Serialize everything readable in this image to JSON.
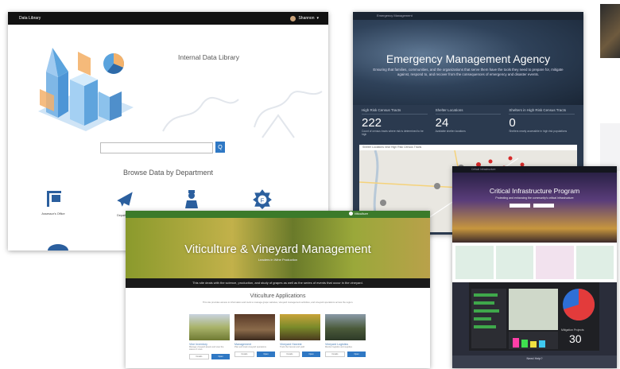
{
  "data_library": {
    "bar_title": "Data Library",
    "user": "Shannon",
    "title": "Internal Data Library",
    "search_button": "Q",
    "browse_heading": "Browse Data by Department",
    "departments": [
      {
        "icon": "sign-icon",
        "label": "Assessor's Office"
      },
      {
        "icon": "airplane-icon",
        "label": "Department"
      }
    ],
    "colors": {
      "accent": "#2f78c4",
      "bar": "#111111"
    }
  },
  "emergency": {
    "topbar": "Emergency Management",
    "title": "Emergency Management Agency",
    "tagline": "Ensuring that families, communities, and the organizations that serve them have the tools they need to prepare for, mitigate against, respond to, and recover from the consequences of emergency and disaster events.",
    "stats": [
      {
        "label": "High Risk Census Tracts",
        "value": "222",
        "desc": "Count of census tracts where risk is determined to be high"
      },
      {
        "label": "Shelter Locations",
        "value": "24",
        "desc": "Available shelter locations"
      },
      {
        "label": "Shelters in High Risk Census Tracts",
        "value": "0",
        "desc": "Shelters nearly accessible in high risk populations"
      }
    ],
    "map_title": "Shelter Locations near High Risk Census Tracts"
  },
  "critical": {
    "topbar": "Critical Infrastructure",
    "title": "Critical Infrastructure Program",
    "subtitle": "Protecting and enhancing the community's critical infrastructure",
    "dashboard_value": "30",
    "dashboard_label": "Mitigation Projects",
    "footer_title": "Need Help?"
  },
  "viticulture": {
    "brand": "Viticulture",
    "title": "Viticulture & Vineyard Management",
    "subtitle": "Leaders in Wine Production",
    "banner": "This site deals with the science, production, and study of grapes as well as the series of events that occur in the vineyard.",
    "apps_title": "Viticulture Applications",
    "apps_desc": "This site provides access to information and tools to manage grape varieties, vineyard management activities, and vineyard operations across the region.",
    "apps": [
      {
        "name": "Vine Inventory",
        "desc": "Manage vineyard assets and view the status of vines",
        "secondary": "Details",
        "primary": "Open"
      },
      {
        "name": "Management",
        "desc": "Plan and track vineyard operations",
        "secondary": "Details",
        "primary": "Open"
      },
      {
        "name": "Vineyard Harvest",
        "desc": "Track the harvest and yield",
        "secondary": "Details",
        "primary": "Open"
      },
      {
        "name": "Vineyard Logistics",
        "desc": "Monitor logistics and supplies",
        "secondary": "Details",
        "primary": "Open"
      }
    ]
  }
}
